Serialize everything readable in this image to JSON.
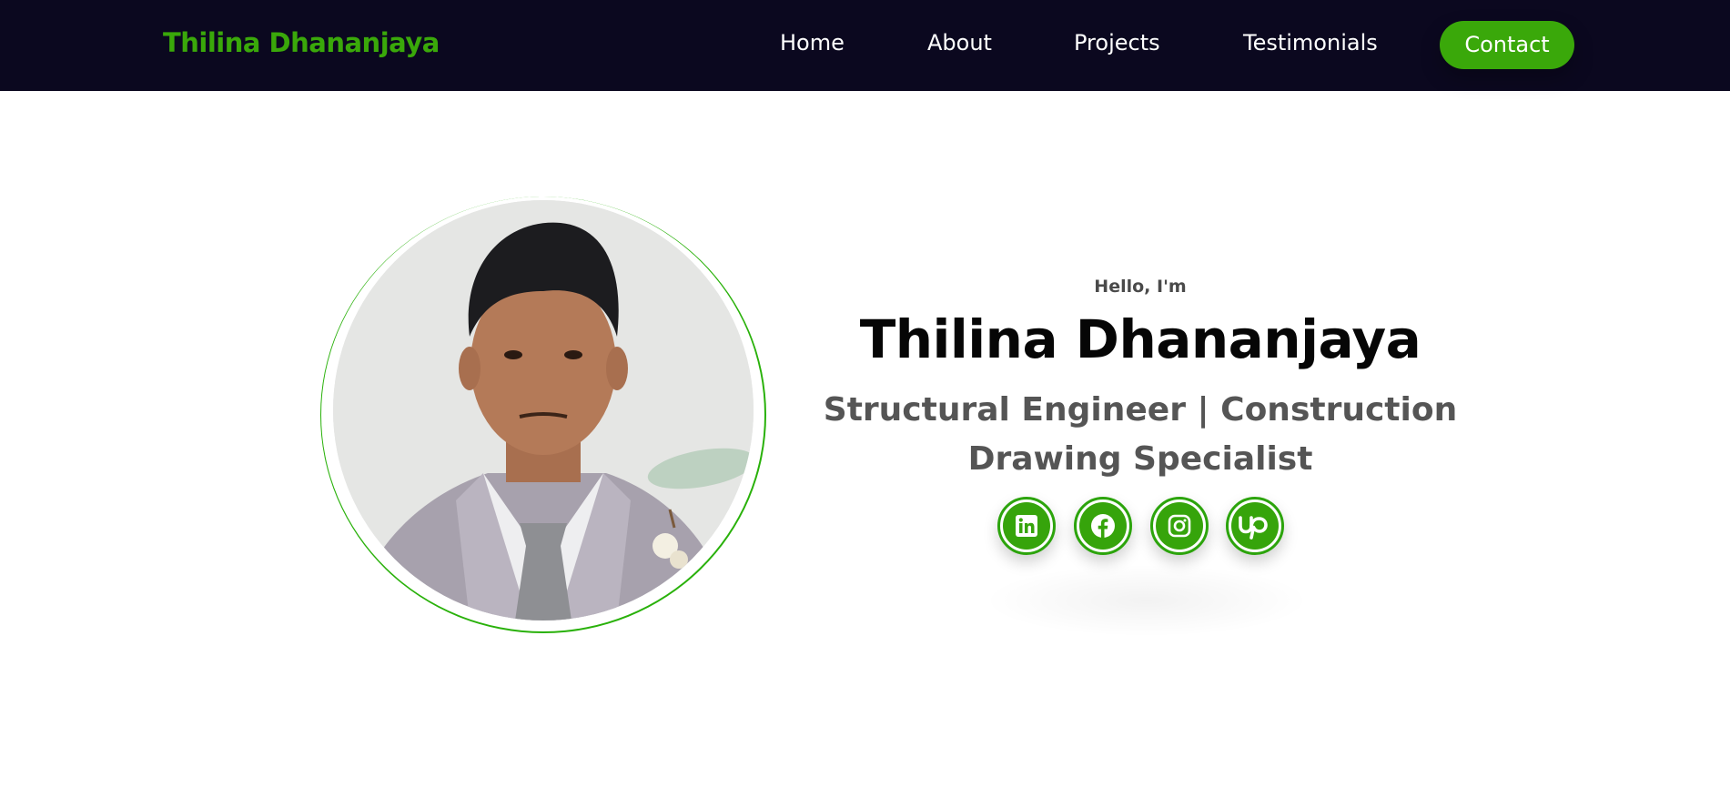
{
  "nav": {
    "brand": "Thilina Dhananjaya",
    "links": [
      "Home",
      "About",
      "Projects",
      "Testimonials"
    ],
    "contact": "Contact"
  },
  "hero": {
    "greeting": "Hello, I'm",
    "name": "Thilina Dhananjaya",
    "role": "Structural Engineer | Construction Drawing Specialist",
    "portrait_alt": "portrait-photo"
  },
  "socials": [
    "linkedin-icon",
    "facebook-icon",
    "instagram-icon",
    "upwork-icon"
  ],
  "colors": {
    "nav_bg": "#0b081f",
    "accent": "#3aa80a",
    "text_dark": "#060606",
    "text_muted": "#555555"
  }
}
